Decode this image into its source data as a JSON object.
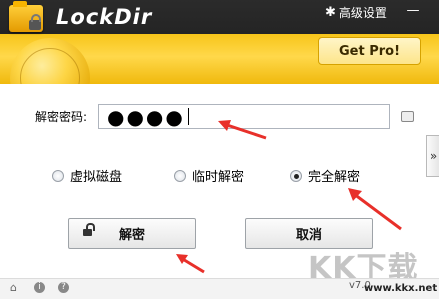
{
  "app": {
    "title": "LockDir"
  },
  "header": {
    "settings_label": "高级设置",
    "minimize_label": "—",
    "getpro_label": "Get Pro!"
  },
  "form": {
    "password_label": "解密密码:",
    "password_dots": "●●●●"
  },
  "options": [
    {
      "label": "虚拟磁盘",
      "checked": false
    },
    {
      "label": "临时解密",
      "checked": false
    },
    {
      "label": "完全解密",
      "checked": true
    }
  ],
  "buttons": {
    "decrypt_label": "解密",
    "cancel_label": "取消"
  },
  "side_toggle": "»",
  "footer": {
    "version": "v7.0"
  },
  "watermark": {
    "big": "KK下载",
    "url": "www.kkx.net"
  },
  "colors": {
    "header_dark": "#1a1a1a",
    "ribbon": "#f7c51a",
    "annotation": "#e8302a"
  },
  "icons": [
    "app-folder-lock-icon",
    "gear-icon",
    "minimize-icon",
    "keyboard-icon",
    "unlock-icon",
    "home-icon",
    "info-icon",
    "help-icon"
  ]
}
